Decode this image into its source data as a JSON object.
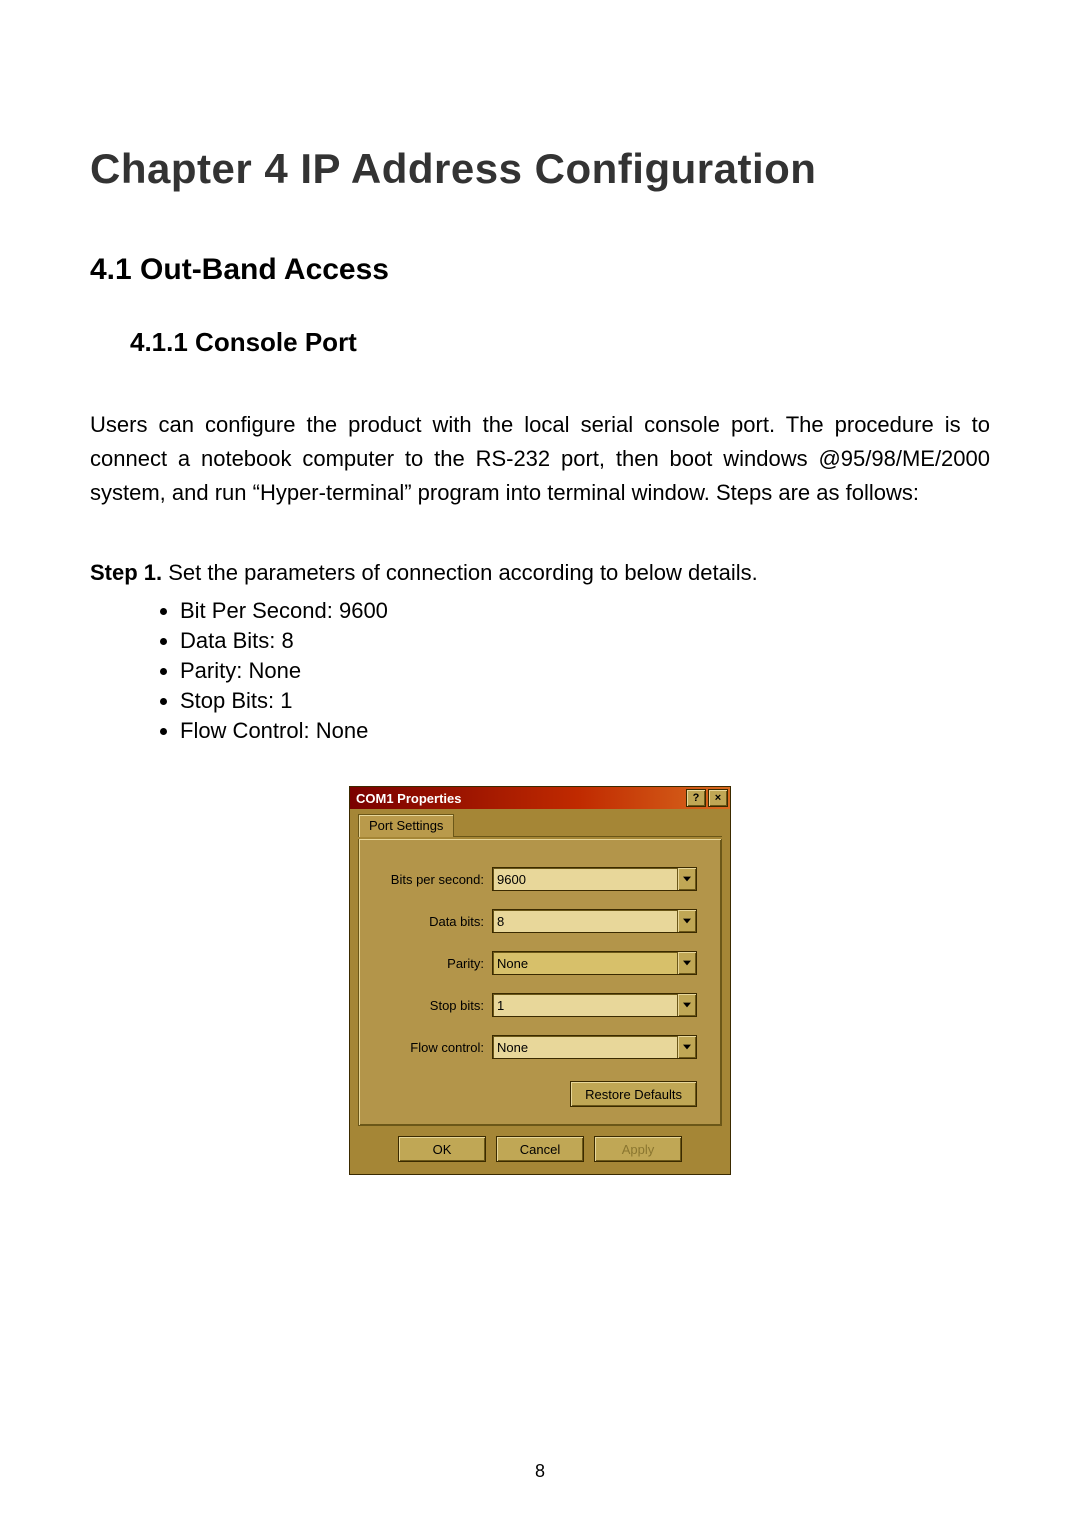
{
  "page_number": "8",
  "chapter_title": "Chapter 4   IP Address Configuration",
  "section_title": "4.1    Out-Band Access",
  "subsec_title": "4.1.1 Console Port",
  "paragraph": "Users can configure the product with the local serial console port. The procedure is to connect a notebook computer to the RS-232 port, then boot windows @95/98/ME/2000 system, and run “Hyper-terminal” program into terminal window. Steps are as follows:",
  "step": {
    "label": "Step 1.",
    "text": " Set the parameters of connection according to below details."
  },
  "bullets": [
    "Bit Per Second: 9600",
    "Data Bits: 8",
    "Parity: None",
    "Stop Bits: 1",
    "Flow Control: None"
  ],
  "dialog": {
    "title": "COM1 Properties",
    "help_glyph": "?",
    "close_glyph": "×",
    "tab_label": "Port Settings",
    "fields": {
      "bps": {
        "label": "Bits per second:",
        "value": "9600"
      },
      "data": {
        "label": "Data bits:",
        "value": "8"
      },
      "parity": {
        "label": "Parity:",
        "value": "None"
      },
      "stop": {
        "label": "Stop bits:",
        "value": "1"
      },
      "flow": {
        "label": "Flow control:",
        "value": "None"
      }
    },
    "restore_label": "Restore Defaults",
    "ok_label": "OK",
    "cancel_label": "Cancel",
    "apply_label": "Apply"
  }
}
